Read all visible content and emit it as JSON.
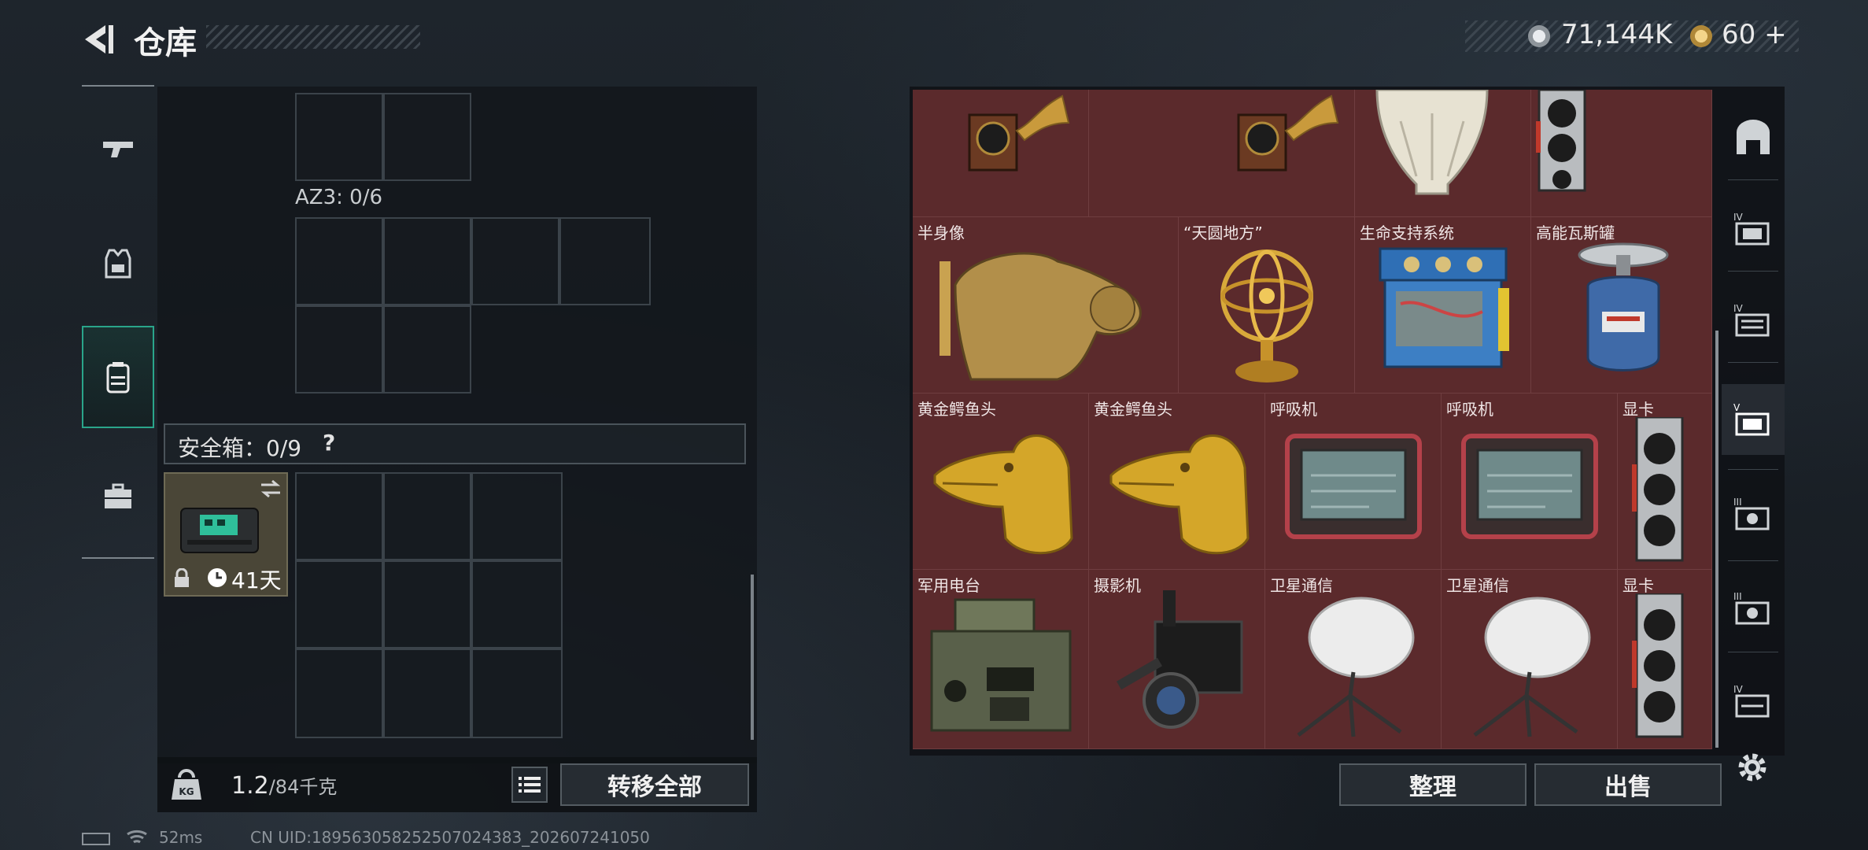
{
  "header": {
    "title": "仓库",
    "currencies": [
      {
        "icon": "silver-coin-icon",
        "amount": "71,144K"
      },
      {
        "icon": "gold-coin-icon",
        "amount": "60 +"
      }
    ]
  },
  "nav": {
    "items": [
      {
        "name": "nav-weapons",
        "icon": "gun-icon",
        "active": false
      },
      {
        "name": "nav-armor",
        "icon": "vest-icon",
        "active": false
      },
      {
        "name": "nav-backpack",
        "icon": "backpack-icon",
        "active": true
      },
      {
        "name": "nav-case",
        "icon": "briefcase-icon",
        "active": false
      }
    ]
  },
  "loadout": {
    "slot_label": "AZ3: 0/6",
    "safe_box_label": "安全箱：0/9",
    "safe_box_help": "?",
    "safe_box_days": "41天",
    "weight_current": "1.2",
    "weight_max": "/84千克",
    "transfer_all": "转移全部"
  },
  "inventory": {
    "items": [
      {
        "row": 0,
        "label": "",
        "icon": "gramophone-icon"
      },
      {
        "row": 0,
        "label": "",
        "icon": "gramophone-icon"
      },
      {
        "row": 0,
        "label": "",
        "icon": "vase-icon"
      },
      {
        "row": 0,
        "label": "",
        "icon": "graphics-card-icon"
      },
      {
        "row": 1,
        "label": "半身像",
        "icon": "bust-icon"
      },
      {
        "row": 1,
        "label": "“天圆地方”",
        "icon": "armillary-sphere-icon"
      },
      {
        "row": 1,
        "label": "生命支持系统",
        "icon": "life-support-icon"
      },
      {
        "row": 1,
        "label": "高能瓦斯罐",
        "icon": "gas-canister-icon"
      },
      {
        "row": 2,
        "label": "黄金鳄鱼头",
        "icon": "golden-crocodile-icon"
      },
      {
        "row": 2,
        "label": "黄金鳄鱼头",
        "icon": "golden-crocodile-icon"
      },
      {
        "row": 2,
        "label": "呼吸机",
        "icon": "ventilator-icon"
      },
      {
        "row": 2,
        "label": "呼吸机",
        "icon": "ventilator-icon"
      },
      {
        "row": 2,
        "label": "显卡",
        "icon": "graphics-card-icon"
      },
      {
        "row": 3,
        "label": "军用电台",
        "icon": "military-radio-icon"
      },
      {
        "row": 3,
        "label": "摄影机",
        "icon": "video-camera-icon"
      },
      {
        "row": 3,
        "label": "卫星通信",
        "icon": "satellite-dish-icon"
      },
      {
        "row": 3,
        "label": "卫星通信",
        "icon": "satellite-dish-icon"
      },
      {
        "row": 3,
        "label": "显卡",
        "icon": "graphics-card-icon"
      }
    ],
    "sort_label": "整理",
    "sell_label": "出售"
  },
  "side_tabs": {
    "items": [
      {
        "icon": "vault-icon",
        "roman": ""
      },
      {
        "icon": "storage-tier-icon",
        "roman": "IV"
      },
      {
        "icon": "storage-tier-icon",
        "roman": "IV"
      },
      {
        "icon": "storage-tier-icon",
        "roman": "V"
      },
      {
        "icon": "storage-tier-icon",
        "roman": "III"
      },
      {
        "icon": "storage-tier-icon",
        "roman": "III"
      },
      {
        "icon": "storage-tier-icon",
        "roman": "IV"
      }
    ],
    "settings": "gear-icon"
  },
  "status": {
    "ping": "52ms",
    "uid": "CN UID:18956305825250702438​3_202607241050"
  },
  "colors": {
    "accent": "#2aa58a",
    "grid_bg": "#5b2a2c",
    "panel": "#12161b"
  }
}
